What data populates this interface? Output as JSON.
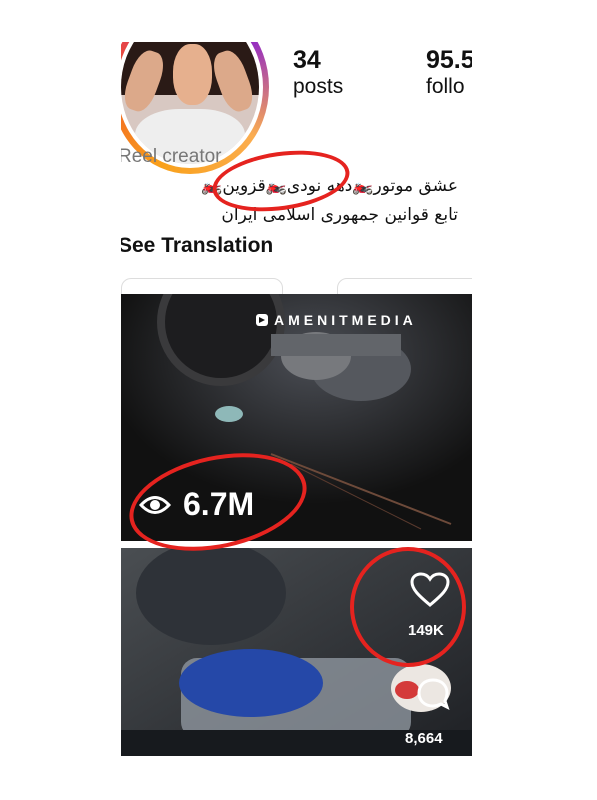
{
  "profile": {
    "posts_count": "34",
    "posts_label": "posts",
    "followers_count": "95.5",
    "followers_label": "follo",
    "category": "Reel creator",
    "bio_line1": "عشق موتور🏍️دهه نودی🏍️قزوین🏍️",
    "bio_line2": "تابع قوانین جمهوری اسلامی ایران",
    "see_translation": "See Translation"
  },
  "reels": [
    {
      "watermark": "AMENITMEDIA",
      "views": "6.7M"
    },
    {
      "likes": "149K",
      "comments": "8,664"
    }
  ],
  "icons": {
    "views": "eye-icon",
    "likes": "heart-icon",
    "comments": "comment-bubble-icon",
    "watermark": "telegram-icon"
  },
  "colors": {
    "annotation_red": "#e5231f",
    "story_ring": "#d62976"
  }
}
